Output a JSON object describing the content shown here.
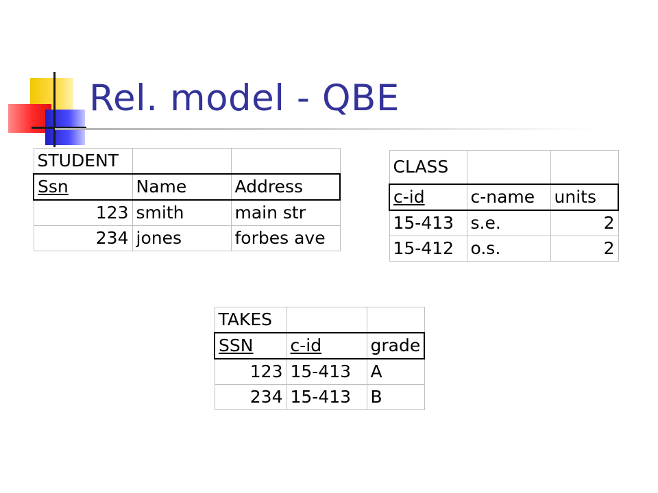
{
  "slide": {
    "title": "Rel. model - QBE"
  },
  "student": {
    "name": "STUDENT",
    "fields": [
      "Ssn",
      "Name",
      "Address"
    ],
    "rows": [
      [
        "123",
        "smith",
        "main str"
      ],
      [
        "234",
        "jones",
        "forbes ave"
      ]
    ]
  },
  "class": {
    "name": "CLASS",
    "fields": [
      "c-id",
      "c-name",
      "units"
    ],
    "rows": [
      [
        "15-413",
        "s.e.",
        "2"
      ],
      [
        "15-412",
        "o.s.",
        "2"
      ]
    ]
  },
  "takes": {
    "name": "TAKES",
    "fields": [
      "SSN",
      "c-id",
      "grade"
    ],
    "rows": [
      [
        "123",
        "15-413",
        "A"
      ],
      [
        "234",
        "15-413",
        "B"
      ]
    ]
  },
  "colors": {
    "title": "#333399",
    "logo_yellow": "#f3c700",
    "logo_red": "#ff2a2a",
    "logo_blue": "#2020c8"
  }
}
